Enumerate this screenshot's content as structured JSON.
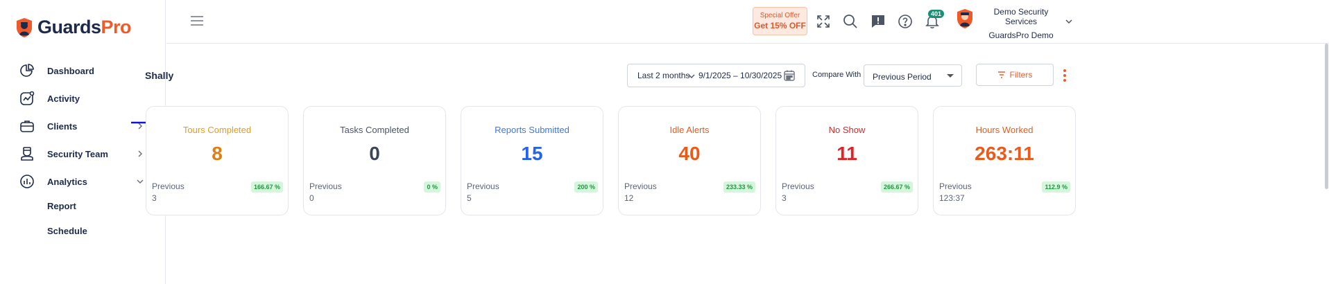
{
  "brand": {
    "name_part1": "Guards",
    "name_part2": "Pro",
    "accent": "#ef5a2a",
    "navy": "#1e2a4a"
  },
  "sidebar": {
    "items": [
      {
        "label": "Dashboard",
        "icon": "pie-chart-icon"
      },
      {
        "label": "Activity",
        "icon": "activity-icon"
      },
      {
        "label": "Clients",
        "icon": "briefcase-icon",
        "has_chevron": true
      },
      {
        "label": "Security Team",
        "icon": "guard-icon",
        "has_chevron": true
      },
      {
        "label": "Analytics",
        "icon": "bar-chart-icon",
        "expanded": true
      }
    ],
    "sub_items": [
      {
        "label": "Report"
      },
      {
        "label": "Schedule"
      }
    ]
  },
  "topbar": {
    "offer_line1": "Special Offer",
    "offer_line2": "Get 15% OFF",
    "notification_count": "401",
    "org_name": "Demo Security Services",
    "org_sub": "GuardsPro Demo"
  },
  "page": {
    "title": "Shally",
    "date_preset": "Last 2 months",
    "date_range": "9/1/2025 – 10/30/2025",
    "compare_label": "Compare With",
    "compare_value": "Previous Period",
    "filters_label": "Filters"
  },
  "cards": [
    {
      "title": "Tours Completed",
      "value": "8",
      "previous_label": "Previous",
      "previous_value": "3",
      "change": "166.67 %",
      "title_color": "#e89a1c",
      "value_color": "#e27d12"
    },
    {
      "title": "Tasks Completed",
      "value": "0",
      "previous_label": "Previous",
      "previous_value": "0",
      "change": "0 %",
      "title_color": "#4a5568",
      "value_color": "#3c4658"
    },
    {
      "title": "Reports Submitted",
      "value": "15",
      "previous_label": "Previous",
      "previous_value": "5",
      "change": "200 %",
      "title_color": "#3f78e0",
      "value_color": "#2563eb"
    },
    {
      "title": "Idle Alerts",
      "value": "40",
      "previous_label": "Previous",
      "previous_value": "12",
      "change": "233.33 %",
      "title_color": "#ea5a1a",
      "value_color": "#ea5a1a"
    },
    {
      "title": "No Show",
      "value": "11",
      "previous_label": "Previous",
      "previous_value": "3",
      "change": "266.67 %",
      "title_color": "#dc2626",
      "value_color": "#dc2626"
    },
    {
      "title": "Hours Worked",
      "value": "263:11",
      "previous_label": "Previous",
      "previous_value": "123:37",
      "change": "112.9 %",
      "title_color": "#ea5a1a",
      "value_color": "#ea5a1a"
    }
  ]
}
